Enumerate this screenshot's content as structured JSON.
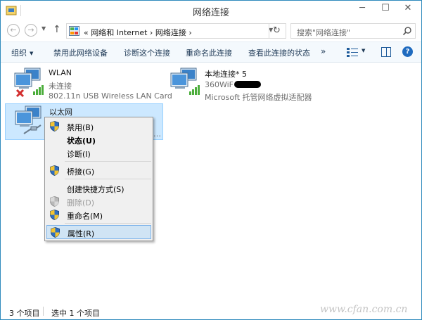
{
  "window": {
    "title": "网络连接"
  },
  "nav": {
    "back_glyph": "←",
    "forward_glyph": "→",
    "up_glyph": "↑",
    "address_prefix": "«",
    "breadcrumb": [
      "网络和 Internet",
      "网络连接"
    ],
    "breadcrumb_sep": "›",
    "refresh_glyph": "↻",
    "search_placeholder": "搜索\"网络连接\""
  },
  "toolbar": {
    "organize": "组织",
    "disable": "禁用此网络设备",
    "diagnose": "诊断这个连接",
    "rename": "重命名此连接",
    "view_status": "查看此连接的状态",
    "more": "»",
    "help": "?"
  },
  "adapters": [
    {
      "name": "WLAN",
      "status": "未连接",
      "device": "802.11n USB Wireless LAN Card",
      "icon": "wifi-adapter-icon",
      "disconnected": true
    },
    {
      "name": "本地连接* 5",
      "status": "360WiF",
      "device": "Microsoft 托管网络虚拟适配器",
      "icon": "wifi-adapter-icon",
      "disconnected": false
    },
    {
      "name": "以太网",
      "status": "",
      "device": "…",
      "icon": "ethernet-adapter-icon",
      "selected": true
    }
  ],
  "context_menu": {
    "items": [
      {
        "label": "禁用(B)",
        "shield": true
      },
      {
        "label": "状态(U)",
        "bold": true
      },
      {
        "label": "诊断(I)"
      },
      {
        "label": "桥接(G)",
        "shield": true
      },
      {
        "label": "创建快捷方式(S)"
      },
      {
        "label": "删除(D)",
        "shield": true,
        "disabled": true
      },
      {
        "label": "重命名(M)",
        "shield": true
      },
      {
        "label": "属性(R)",
        "shield": true,
        "hovered": true
      }
    ]
  },
  "status": {
    "item_count": "3 个项目",
    "selected": "选中 1 个项目"
  },
  "watermark": "www.cfan.com.cn",
  "colors": {
    "window_border": "#2f8bbd",
    "selection_bg": "#cce8ff",
    "toolbar_text": "#1e3956",
    "menu_hover": "#d0e4f4"
  }
}
